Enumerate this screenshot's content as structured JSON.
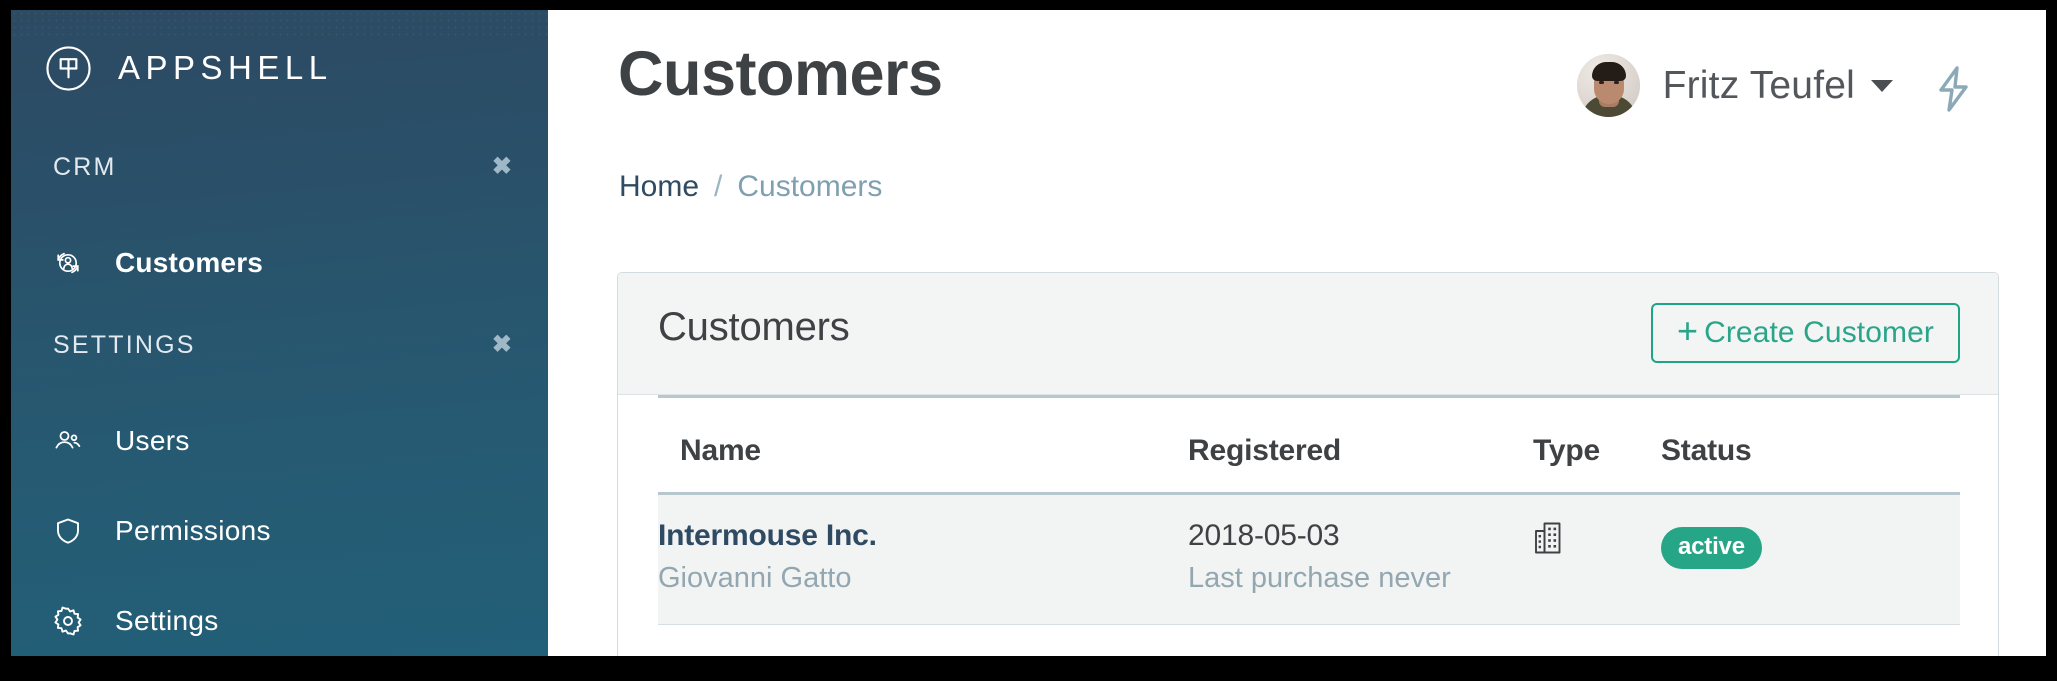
{
  "brand": {
    "name": "APPSHELL",
    "logo_icon": "gearshift-circle-logo-icon"
  },
  "sidebar": {
    "sections": [
      {
        "title": "CRM",
        "close_glyph": "✖",
        "items": [
          {
            "label": "Customers",
            "icon": "customer-account-icon",
            "active": true
          }
        ]
      },
      {
        "title": "SETTINGS",
        "close_glyph": "✖",
        "items": [
          {
            "label": "Users",
            "icon": "users-icon",
            "active": false
          },
          {
            "label": "Permissions",
            "icon": "shield-icon",
            "active": false
          },
          {
            "label": "Settings",
            "icon": "gear-icon",
            "active": false
          }
        ]
      }
    ]
  },
  "header": {
    "page_title": "Customers",
    "user_name": "Fritz Teufel",
    "user_caret_icon": "chevron-down-icon",
    "avatar_icon": "user-avatar",
    "bolt_icon": "lightning-bolt-icon"
  },
  "breadcrumb": {
    "home": "Home",
    "separator": "/",
    "current": "Customers"
  },
  "card": {
    "title": "Customers",
    "create_button": {
      "plus": "+",
      "label": "Create Customer"
    },
    "table": {
      "columns": [
        "Name",
        "Registered",
        "Type",
        "Status"
      ],
      "rows": [
        {
          "name": "Intermouse Inc.",
          "contact": "Giovanni Gatto",
          "registered": "2018-05-03",
          "last_purchase": "Last purchase never",
          "type_icon": "building-icon",
          "status": "active"
        }
      ]
    }
  },
  "colors": {
    "sidebar_top": "#2d4a63",
    "sidebar_bottom": "#225f78",
    "accent_teal": "#26a587",
    "breadcrumb_link": "#2f4a63",
    "breadcrumb_muted": "#7fa0b1",
    "text_dark": "#3f4244",
    "text_muted": "#93a7b1",
    "card_header_bg": "#f3f4f4",
    "row_bg": "#f2f3f3",
    "frame": "#000000"
  }
}
